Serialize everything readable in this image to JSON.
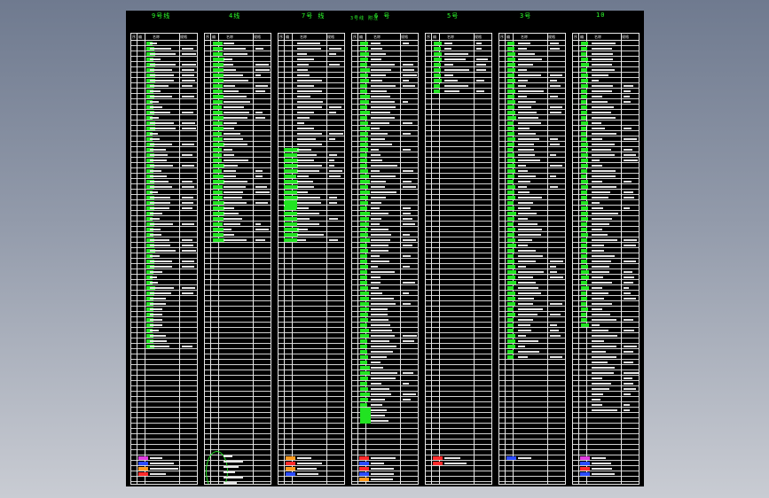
{
  "groups": [
    {
      "id": "g1",
      "title": "9号线",
      "hdr": [
        "序",
        "编",
        "名称",
        "规格"
      ]
    },
    {
      "id": "g2",
      "title": "4线",
      "hdr": [
        "序",
        "编",
        "名称",
        "规格"
      ]
    },
    {
      "id": "g3",
      "title": "7号 线",
      "hdr": [
        "序",
        "编",
        "名称",
        "规格"
      ]
    },
    {
      "id": "g4",
      "title": "6 号",
      "hdr": [
        "序",
        "编",
        "名称",
        "规格"
      ]
    },
    {
      "id": "g5",
      "title": "5号",
      "hdr": [
        "序",
        "编",
        "名称",
        "规格"
      ]
    },
    {
      "id": "g6",
      "title": "3号",
      "hdr": [
        "序",
        "编",
        "名称",
        "规格"
      ]
    },
    {
      "id": "g7",
      "title": "10",
      "hdr": [
        "序",
        "编",
        "名称",
        "规格"
      ]
    }
  ],
  "annotation": "3号线 附注"
}
